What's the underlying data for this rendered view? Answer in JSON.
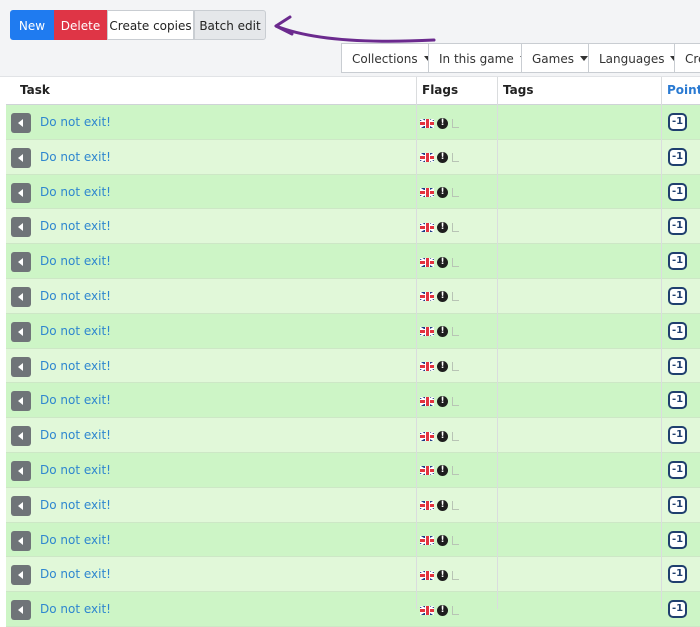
{
  "toolbar": {
    "new_label": "New",
    "delete_label": "Delete",
    "copies_label": "Create copies",
    "batch_label": "Batch edit",
    "colors": {
      "new": "#1f7bf0",
      "delete": "#df3546",
      "annotation_arrow": "#6b2a8e"
    }
  },
  "filters": [
    {
      "label": "Collections"
    },
    {
      "label": "In this game"
    },
    {
      "label": "Games"
    },
    {
      "label": "Languages"
    },
    {
      "label": "Cre"
    }
  ],
  "table": {
    "columns": {
      "task": "Task",
      "flags": "Flags",
      "tags": "Tags",
      "points": "Points"
    },
    "rows": [
      {
        "task": "Do not exit!",
        "flag": "uk-flag",
        "points": "-1"
      },
      {
        "task": "Do not exit!",
        "flag": "uk-flag",
        "points": "-1"
      },
      {
        "task": "Do not exit!",
        "flag": "uk-flag",
        "points": "-1"
      },
      {
        "task": "Do not exit!",
        "flag": "uk-flag",
        "points": "-1"
      },
      {
        "task": "Do not exit!",
        "flag": "uk-flag",
        "points": "-1"
      },
      {
        "task": "Do not exit!",
        "flag": "uk-flag",
        "points": "-1"
      },
      {
        "task": "Do not exit!",
        "flag": "uk-flag",
        "points": "-1"
      },
      {
        "task": "Do not exit!",
        "flag": "uk-flag",
        "points": "-1"
      },
      {
        "task": "Do not exit!",
        "flag": "uk-flag",
        "points": "-1"
      },
      {
        "task": "Do not exit!",
        "flag": "uk-flag",
        "points": "-1"
      },
      {
        "task": "Do not exit!",
        "flag": "uk-flag",
        "points": "-1"
      },
      {
        "task": "Do not exit!",
        "flag": "uk-flag",
        "points": "-1"
      },
      {
        "task": "Do not exit!",
        "flag": "uk-flag",
        "points": "-1"
      },
      {
        "task": "Do not exit!",
        "flag": "uk-flag",
        "points": "-1"
      },
      {
        "task": "Do not exit!",
        "flag": "uk-flag",
        "points": "-1"
      }
    ]
  }
}
